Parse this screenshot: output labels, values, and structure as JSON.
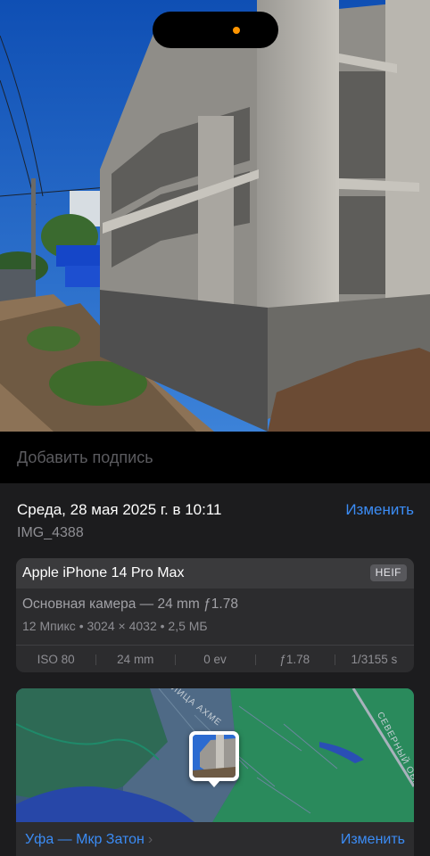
{
  "caption": {
    "placeholder": "Добавить подпись"
  },
  "info": {
    "date": "Среда, 28 мая 2025 г. в 10:11",
    "edit_label": "Изменить",
    "filename": "IMG_4388"
  },
  "camera": {
    "device": "Apple iPhone 14 Pro Max",
    "format_badge": "HEIF",
    "lens": "Основная камера — 24 mm ƒ1.78",
    "specs": "12 Мпикс • 3024 × 4032 • 2,5 МБ",
    "exif": {
      "iso": "ISO 80",
      "focal": "24 mm",
      "ev": "0 ev",
      "aperture": "ƒ1.78",
      "shutter": "1/3155 s"
    }
  },
  "map": {
    "street_label_1": "ЛИЦА АХМЕ",
    "street_label_2": "СЕВЕРНЫЙ ОБХОД"
  },
  "location": {
    "name": "Уфа — Мкр Затон",
    "chevron": "›",
    "edit_label": "Изменить"
  },
  "colors": {
    "accent": "#3b8cf5",
    "sheet_bg": "#1c1c1e",
    "card_bg": "#2c2c2e",
    "status_dot": "#ff9500"
  },
  "icons": {
    "status_dot": "orange-privacy-dot",
    "location_chevron": "chevron-right-icon"
  }
}
